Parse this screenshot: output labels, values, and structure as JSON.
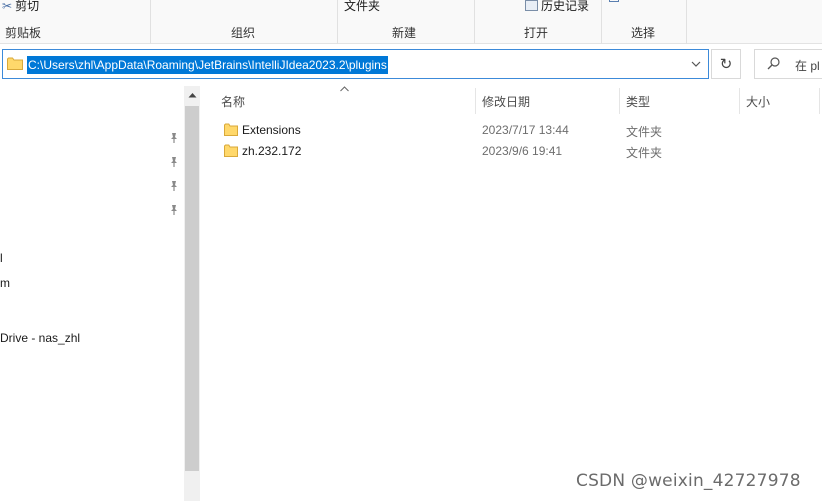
{
  "ribbon": {
    "clipboard": {
      "cut_label": "剪切",
      "group_label": "剪贴板"
    },
    "organize": {
      "group_label": "组织"
    },
    "new": {
      "folder_label": "文件夹",
      "group_label": "新建"
    },
    "open": {
      "history_label": "历史记录",
      "group_label": "打开"
    },
    "select": {
      "group_label": "选择"
    }
  },
  "address_bar": {
    "path": "C:\\Users\\zhl\\AppData\\Roaming\\JetBrains\\IntelliJIdea2023.2\\plugins",
    "folder_icon": "folder-icon",
    "dropdown_icon": "chevron-down-icon",
    "refresh_icon": "refresh-icon",
    "highlight_color": "#0078d7"
  },
  "search": {
    "icon": "search-icon",
    "placeholder": "在 pl"
  },
  "nav_pane": {
    "pin_icon": "pin-icon",
    "items": [
      {
        "label": "l"
      },
      {
        "label": "m"
      },
      {
        "label": "Drive - nas_zhl"
      }
    ]
  },
  "file_list": {
    "columns": {
      "name": "名称",
      "date": "修改日期",
      "type": "类型",
      "size": "大小"
    },
    "rows": [
      {
        "name": "Extensions",
        "date": "2023/7/17 13:44",
        "type": "文件夹",
        "size": ""
      },
      {
        "name": "zh.232.172",
        "date": "2023/9/6 19:41",
        "type": "文件夹",
        "size": ""
      }
    ],
    "folder_color": "#ffd86b"
  },
  "watermark": "CSDN @weixin_42727978"
}
